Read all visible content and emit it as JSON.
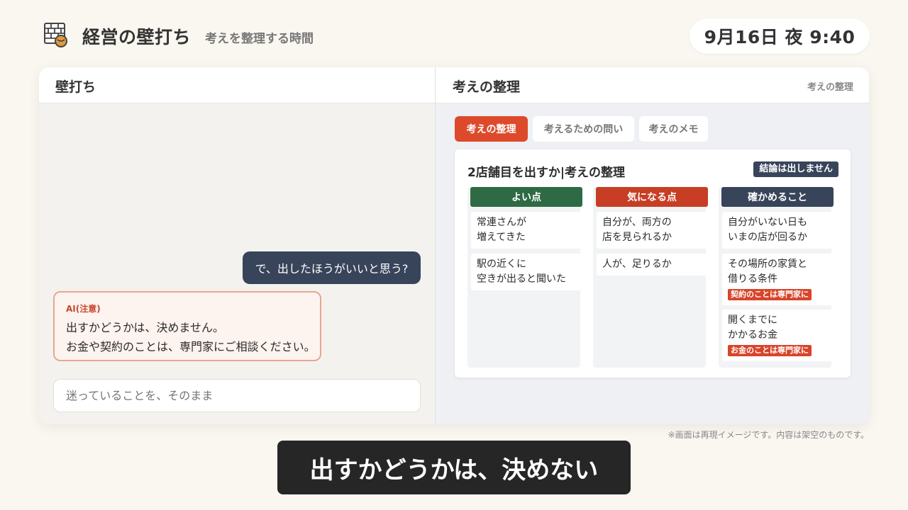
{
  "header": {
    "icon": "brick-wall-ball-icon",
    "title": "経営の壁打ち",
    "subtitle": "考えを整理する時間",
    "clock": "9月16日 夜 9:40"
  },
  "left_panel": {
    "title": "壁打ち",
    "user_message": "で、出したほうがいいと思う?",
    "ai_card": {
      "label": "AI(注意)",
      "lines": [
        "出すかどうかは、決めません。",
        "お金や契約のことは、専門家にご相談ください。"
      ]
    },
    "input": {
      "placeholder": "迷っていることを、そのまま",
      "value": ""
    }
  },
  "right_panel": {
    "title": "考えの整理",
    "hint": "考えの整理",
    "tabs": [
      {
        "label": "考えの整理",
        "active": true
      },
      {
        "label": "考えるための問い",
        "active": false
      },
      {
        "label": "考えのメモ",
        "active": false
      }
    ],
    "sheet": {
      "title": "2店舗目を出すか|考えの整理",
      "badge": "結論は出しません",
      "columns": [
        {
          "header": "よい点",
          "color": "#2e6b45",
          "notes": [
            {
              "lines": [
                "常連さんが",
                "増えてきた"
              ]
            },
            {
              "lines": [
                "駅の近くに",
                "空きが出ると聞いた"
              ]
            }
          ]
        },
        {
          "header": "気になる点",
          "color": "#c73e24",
          "notes": [
            {
              "lines": [
                "自分が、両方の",
                "店を見られるか"
              ]
            },
            {
              "lines": [
                "人が、足りるか"
              ]
            }
          ]
        },
        {
          "header": "確かめること",
          "color": "#37445a",
          "notes": [
            {
              "lines": [
                "自分がいない日も",
                "いまの店が回るか"
              ]
            },
            {
              "lines": [
                "その場所の家賃と",
                "借りる条件"
              ],
              "tag": "契約のことは専門家に"
            },
            {
              "lines": [
                "開くまでに",
                "かかるお金"
              ],
              "tag": "お金のことは専門家に"
            }
          ]
        }
      ]
    }
  },
  "disclaimer": "※画面は再現イメージです。内容は架空のものです。",
  "caption": "出すかどうかは、決めない"
}
